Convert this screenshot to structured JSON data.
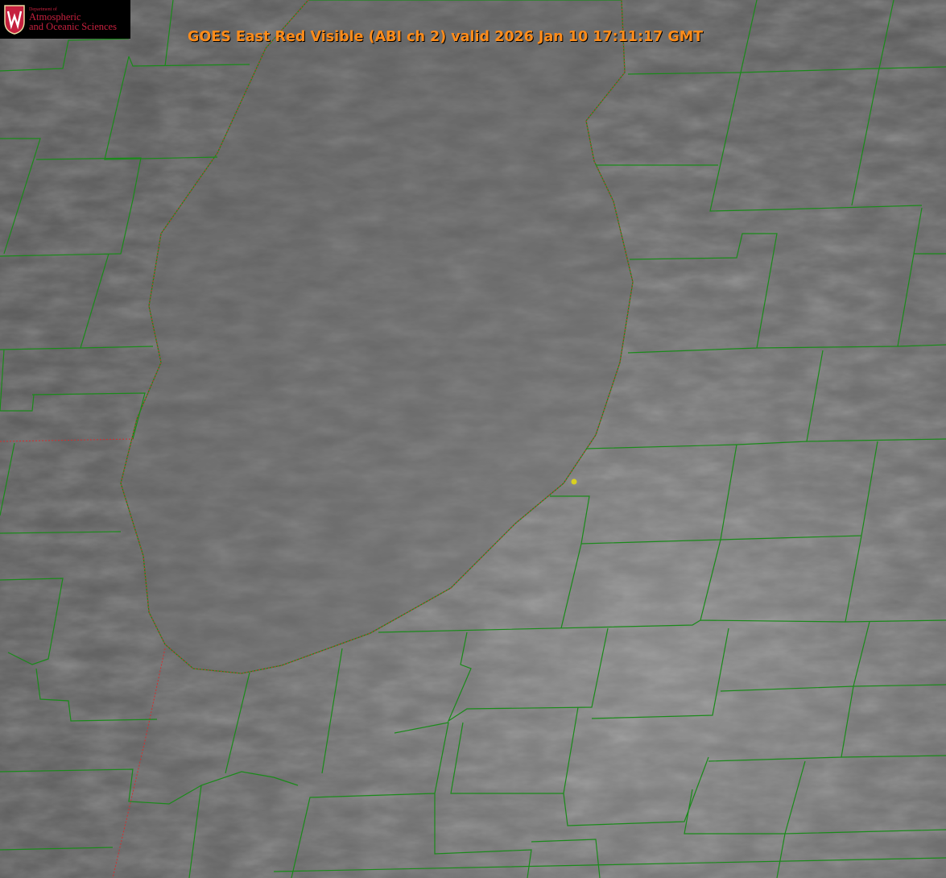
{
  "title": "GOES East Red Visible (ABI ch 2) valid 2026 Jan 10 17:11:17 GMT",
  "logo": {
    "line1": "Department of",
    "line2": "Atmospheric",
    "line3": "and Oceanic Sciences",
    "crest_letter": "W"
  },
  "colors": {
    "title": "#ff8c1a",
    "county_lines": "#1a8a1a",
    "state_line": "#d03030",
    "marker": "#d8d020",
    "logo_text": "#c5203e"
  }
}
